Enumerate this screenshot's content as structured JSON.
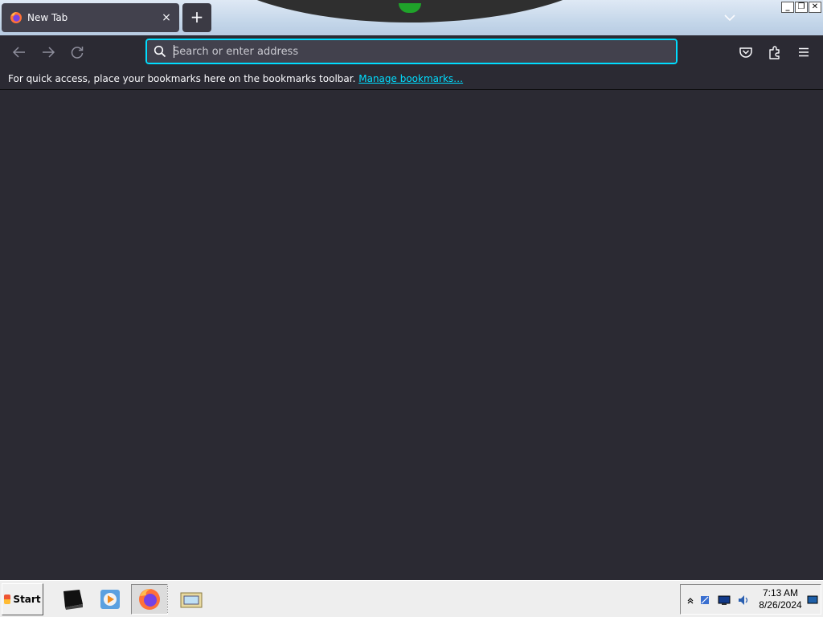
{
  "browser": {
    "tab": {
      "title": "New Tab",
      "close_glyph": "×"
    },
    "new_tab_glyph": "+",
    "urlbar": {
      "placeholder": "Search or enter address",
      "value": ""
    },
    "bookmarks_bar": {
      "message": "For quick access, place your bookmarks here on the bookmarks toolbar.",
      "link": "Manage bookmarks…"
    },
    "colors": {
      "accent": "#00ddff",
      "chrome": "#2b2a33",
      "tab": "#42414d"
    }
  },
  "window_controls": {
    "minimize": "_",
    "restore": "❐",
    "close": "✕"
  },
  "taskbar": {
    "start_label": "Start",
    "clock": {
      "time": "7:13 AM",
      "date": "8/26/2024"
    },
    "tasks": [
      "terminal-icon",
      "media-player-icon",
      "firefox-icon",
      "file-manager-icon"
    ]
  }
}
